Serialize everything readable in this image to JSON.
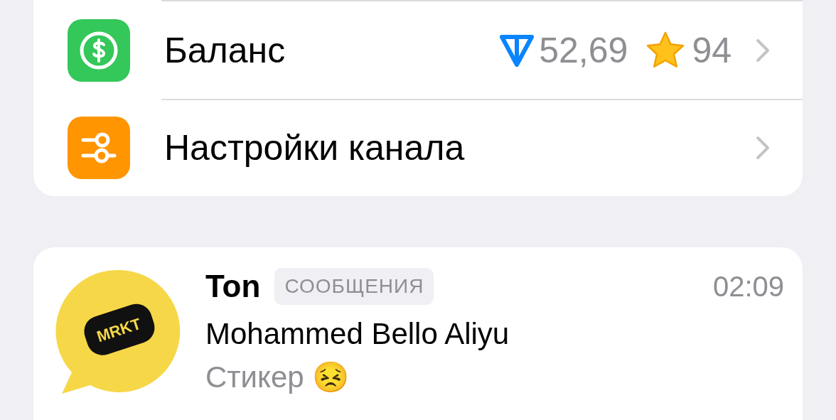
{
  "settings_rows": [
    {
      "kind": "balance",
      "label": "Баланс",
      "ton_amount": "52,69",
      "stars_amount": "94"
    },
    {
      "kind": "plain",
      "label": "Настройки канала"
    }
  ],
  "chat": {
    "avatar_text": "MRKT",
    "name": "Ton",
    "tag": "СООБЩЕНИЯ",
    "time": "02:09",
    "sender": "Mohammed Bello Aliyu",
    "preview": "Стикер 😣"
  }
}
